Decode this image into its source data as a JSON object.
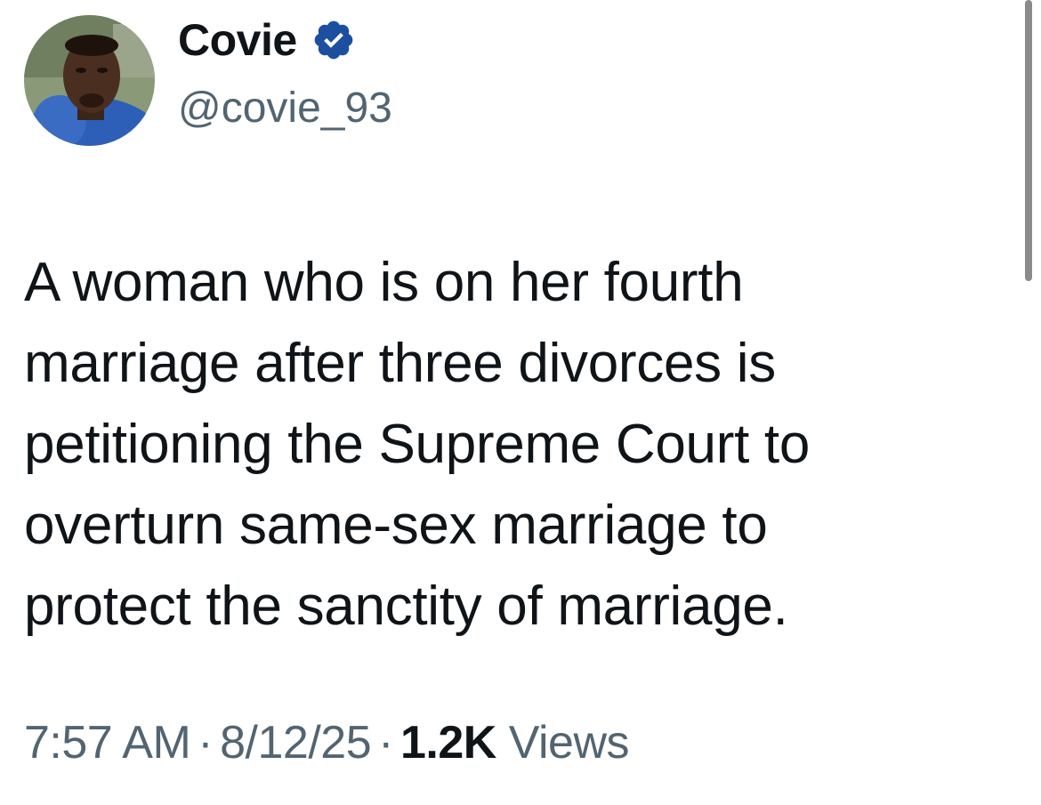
{
  "author": {
    "display_name": "Covie",
    "handle": "@covie_93",
    "verified_icon": "verified-badge-icon",
    "verified_color": "#1d4fa0"
  },
  "tweet": {
    "lines": [
      "A woman who is on her fourth",
      "marriage after three divorces is",
      "petitioning the Supreme Court to",
      "overturn same-sex marriage to",
      "protect the sanctity of marriage."
    ]
  },
  "meta": {
    "time": "7:57 AM",
    "separator": "·",
    "date": "8/12/25",
    "views_count": "1.2K",
    "views_label": "Views"
  },
  "colors": {
    "text_primary": "#0f1419",
    "text_secondary": "#536471",
    "background": "#ffffff"
  }
}
